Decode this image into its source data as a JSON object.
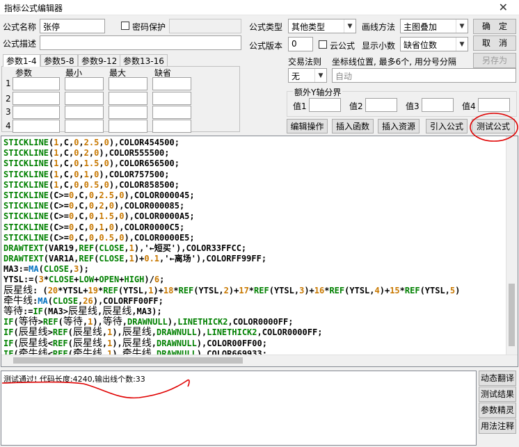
{
  "window": {
    "title": "指标公式编辑器",
    "close_glyph": "✕"
  },
  "form": {
    "name_label": "公式名称",
    "name_value": "张停",
    "password_label": "密码保护",
    "desc_label": "公式描述",
    "type_label": "公式类型",
    "type_value": "其他类型",
    "draw_label": "画线方法",
    "draw_value": "主图叠加",
    "version_label": "公式版本",
    "version_value": "0",
    "cloud_label": "云公式",
    "decimals_label": "显示小数",
    "decimals_value": "缺省位数",
    "trade_label": "交易法则",
    "trade_value": "无",
    "coord_label": "坐标线位置, 最多6个, 用分号分隔",
    "coord_placeholder": "自动"
  },
  "buttons": {
    "ok": "确　定",
    "cancel": "取　消",
    "save_as": "另存为",
    "edit_ops": "编辑操作",
    "insert_func": "插入函数",
    "insert_res": "插入资源",
    "import": "引入公式",
    "test": "测试公式",
    "dyn_translate": "动态翻译",
    "test_result": "测试结果",
    "param_tune": "参数精灵",
    "usage_note": "用法注释"
  },
  "tabs": [
    "参数1-4",
    "参数5-8",
    "参数9-12",
    "参数13-16"
  ],
  "params": {
    "headers": [
      "参数",
      "最小",
      "最大",
      "缺省"
    ],
    "rows": [
      "1",
      "2",
      "3",
      "4"
    ]
  },
  "yaxis": {
    "title": "额外Y轴分界",
    "labels": [
      "值1",
      "值2",
      "值3",
      "值4"
    ]
  },
  "output": {
    "text": "测试通过! 代码长度:4240,输出线个数:33"
  },
  "colors": {
    "annotation": "#e00000"
  }
}
